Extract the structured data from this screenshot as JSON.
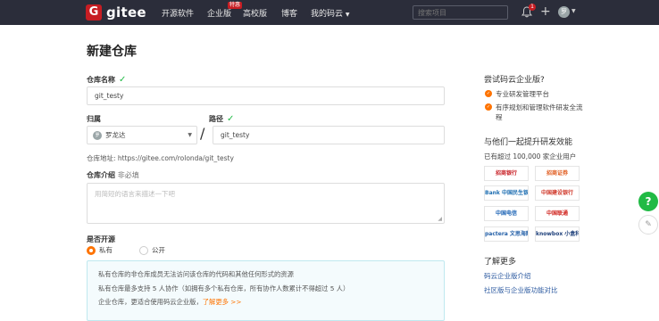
{
  "nav": {
    "logo_mark": "G",
    "logo_text": "gitee",
    "links": [
      "开源软件",
      "企业版",
      "高校版",
      "博客",
      "我的码云"
    ],
    "hot_badge": "特惠",
    "search_placeholder": "搜索项目",
    "notification_count": "1",
    "avatar_initial": "罗"
  },
  "form": {
    "title": "新建仓库",
    "repo_name_label": "仓库名称",
    "repo_name_value": "git_testy",
    "owner_label": "归属",
    "owner_avatar": "罗",
    "owner_value": "罗龙达",
    "path_label": "路径",
    "path_value": "git_testy",
    "address": "仓库地址: https://gitee.com/rolonda/git_testy",
    "desc_label": "仓库介绍",
    "desc_optional": "非必填",
    "desc_placeholder": "用简短的语言来描述一下吧",
    "open_source_label": "是否开源",
    "private_label": "私有",
    "public_label": "公开",
    "info_line1": "私有仓库的非仓库成员无法访问该仓库的代码和其他任何形式的资源",
    "info_line2": "私有仓库最多支持 5 人协作（如拥有多个私有仓库，所有协作人数累计不得超过 5 人）",
    "info_line3_prefix": "企业仓库，更适合使用码云企业版，",
    "info_line3_link": "了解更多 >>"
  },
  "sidebar": {
    "try_title": "尝试码云企业版?",
    "features": [
      "专业研发管理平台",
      "有序规划和管理软件研发全流程"
    ],
    "boost_title": "与他们一起提升研发效能",
    "users_text": "已有超过 100,000 家企业用户",
    "logos": [
      "招商银行",
      "招商证券",
      "Bank 中国民生银行",
      "中国建设银行",
      "中国电信",
      "中国联通",
      "pactera 文思海辉",
      "knowbox 小盒科技"
    ],
    "more_title": "了解更多",
    "links": [
      "码云企业版介绍",
      "社区版与企业版功能对比"
    ]
  },
  "floating": {
    "help": "?",
    "edit": "✎"
  },
  "colors": {
    "accent": "#fe7300",
    "brand": "#c71d23",
    "success": "#21ba45",
    "nav_bg": "#2b2d3a"
  }
}
